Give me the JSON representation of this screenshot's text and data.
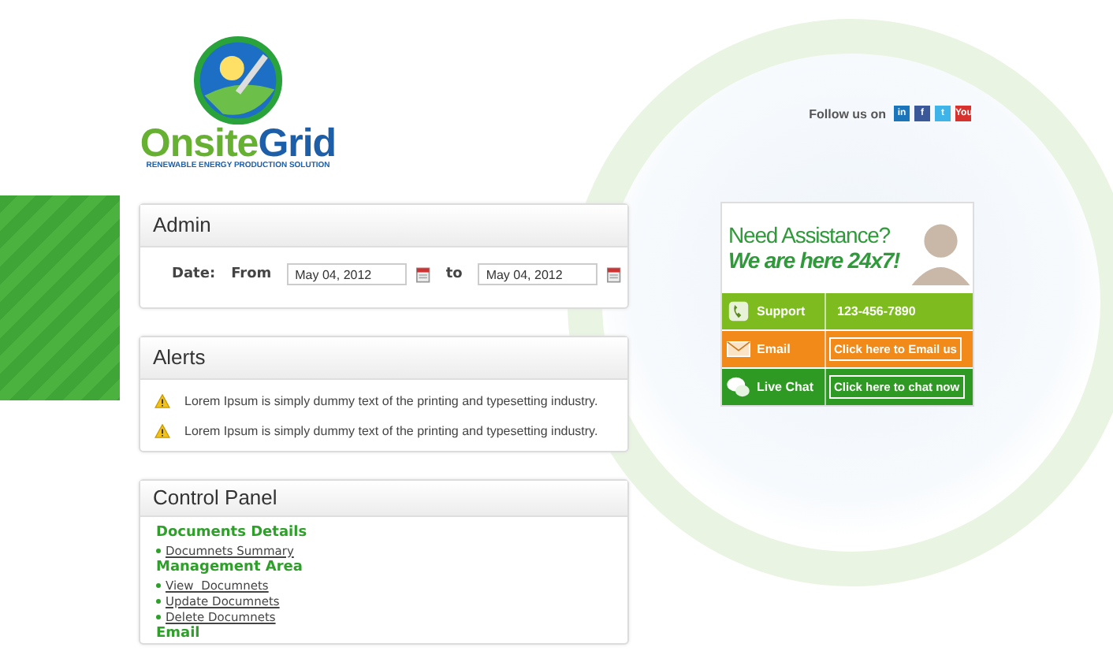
{
  "logo": {
    "name_part_1": "Onsite",
    "name_part_2": "Grid",
    "tagline": "RENEWABLE ENERGY PRODUCTION SOLUTION"
  },
  "social": {
    "label": "Follow us on",
    "icons": [
      {
        "kind": "linkedin",
        "text": "in"
      },
      {
        "kind": "facebook",
        "text": "f"
      },
      {
        "kind": "twitter",
        "text": "t"
      },
      {
        "kind": "youtube",
        "text": "You"
      }
    ]
  },
  "admin": {
    "title": "Admin",
    "date_label": "Date:",
    "from_label": "From",
    "from_value": "May 04, 2012",
    "to_label": "to",
    "to_value": "May 04, 2012"
  },
  "alerts": {
    "title": "Alerts",
    "items": [
      {
        "text": "Lorem Ipsum is simply dummy text of the printing and typesetting industry."
      },
      {
        "text": "Lorem Ipsum is simply dummy text of the printing and typesetting industry."
      }
    ]
  },
  "control_panel": {
    "title": "Control Panel",
    "sections": [
      {
        "heading": "Documents Details",
        "links": [
          "Documnets Summary"
        ]
      },
      {
        "heading": "Management Area",
        "links": [
          "View  Documnets",
          "Update Documnets",
          "Delete Documnets"
        ]
      },
      {
        "heading": "Email"
      }
    ]
  },
  "assistance": {
    "line_1": "Need Assistance?",
    "line_2": "We are here 24x7!",
    "rows": [
      {
        "kind": "phone",
        "color": "#7dbb1f",
        "label": "Support",
        "value": "123-456-7890",
        "is_button": false
      },
      {
        "kind": "email",
        "color": "#f28a1a",
        "label": "Email",
        "value": "Click here to Email us",
        "is_button": true
      },
      {
        "kind": "chat",
        "color": "#2e9a23",
        "label": "Live Chat",
        "value": "Click here to chat now",
        "is_button": true
      }
    ]
  }
}
